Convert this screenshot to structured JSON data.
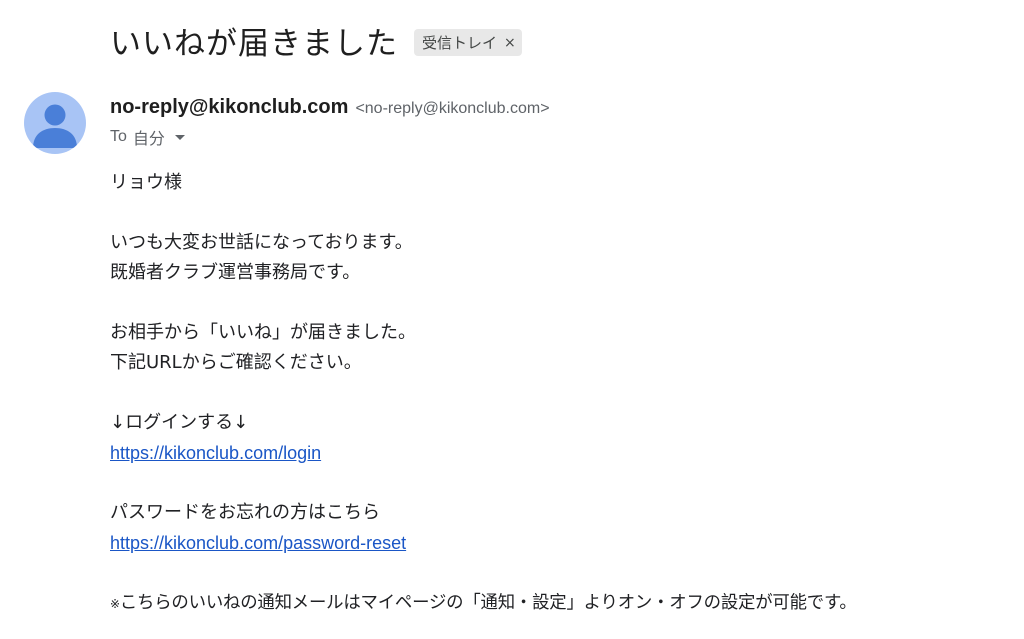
{
  "email": {
    "subject": "いいねが届きました",
    "label_chip": "受信トレイ",
    "label_chip_close": "×",
    "sender": {
      "name": "no-reply@kikonclub.com",
      "email": "<no-reply@kikonclub.com>",
      "avatar_icon": "person-icon",
      "avatar_color": "#a8c4f5",
      "avatar_figure_color": "#4a7fd8"
    },
    "recipient": {
      "prefix": "To",
      "name": "自分",
      "details_icon": "caret-down-icon"
    },
    "body": {
      "greeting": "リョウ様",
      "intro_line1": "いつも大変お世話になっております。",
      "intro_line2": "既婚者クラブ運営事務局です。",
      "notice_line1": "お相手から「いいね」が届きました。",
      "notice_line2": "下記URLからご確認ください。",
      "login_heading": "↓ログインする↓",
      "login_link": "https://kikonclub.com/login",
      "password_heading": "パスワードをお忘れの方はこちら",
      "password_link": "https://kikonclub.com/password-reset",
      "footer_mark": "※",
      "footer_text": "こちらのいいねの通知メールはマイページの「通知・設定」よりオン・オフの設定が可能です。"
    },
    "link_color": "#1a56c6"
  }
}
